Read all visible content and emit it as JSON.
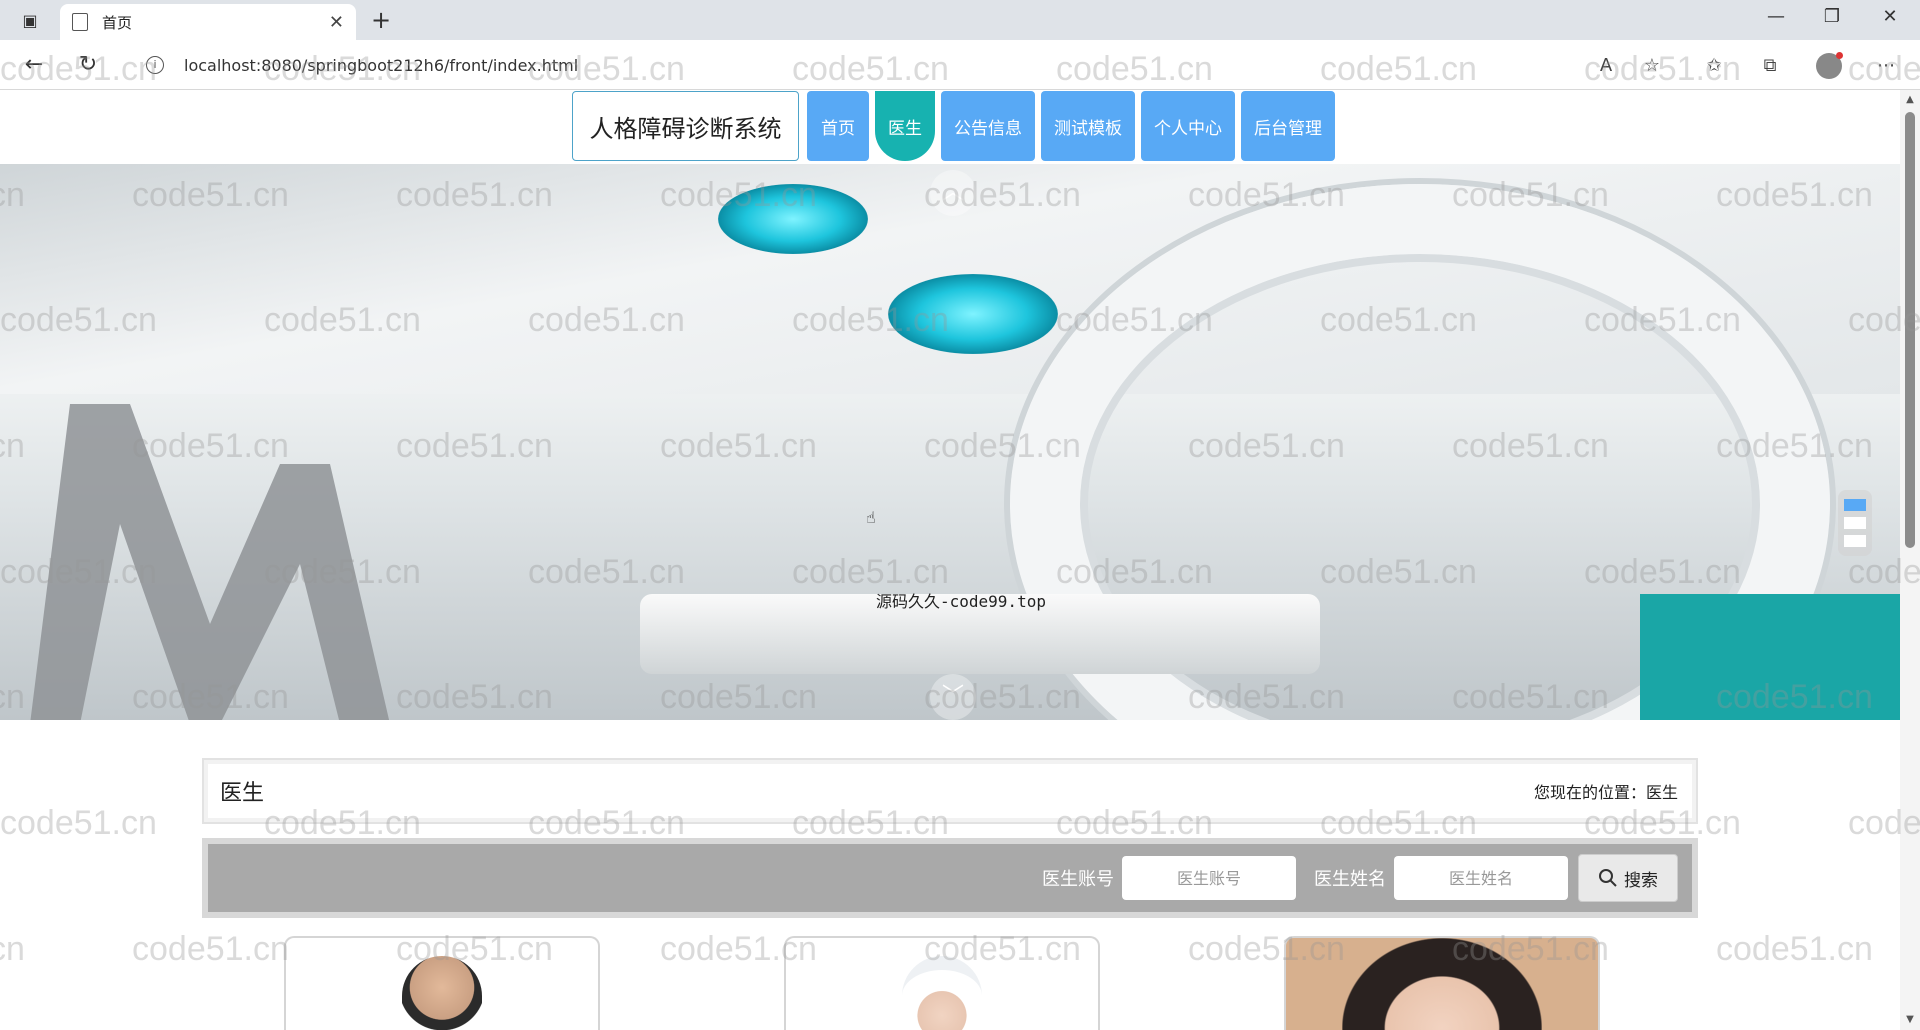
{
  "browser": {
    "tab_title": "首页",
    "url": "localhost:8080/springboot212h6/front/index.html"
  },
  "nav": {
    "brand": "人格障碍诊断系统",
    "items": [
      {
        "label": "首页",
        "active": false
      },
      {
        "label": "医生",
        "active": true
      },
      {
        "label": "公告信息",
        "active": false
      },
      {
        "label": "测试模板",
        "active": false
      },
      {
        "label": "个人中心",
        "active": false
      },
      {
        "label": "后台管理",
        "active": false
      }
    ]
  },
  "hero": {
    "caption": "源码久久-code99.top"
  },
  "breadcrumb": {
    "title": "医生",
    "location_prefix": "您现在的位置：",
    "location": "医生"
  },
  "search": {
    "account_label": "医生账号",
    "account_placeholder": "医生账号",
    "name_label": "医生姓名",
    "name_placeholder": "医生姓名",
    "button_label": "搜索"
  },
  "watermark": "code51.cn",
  "colors": {
    "nav_blue": "#58a9f5",
    "nav_active": "#17b2b0",
    "search_bg": "#a9a9a9"
  }
}
